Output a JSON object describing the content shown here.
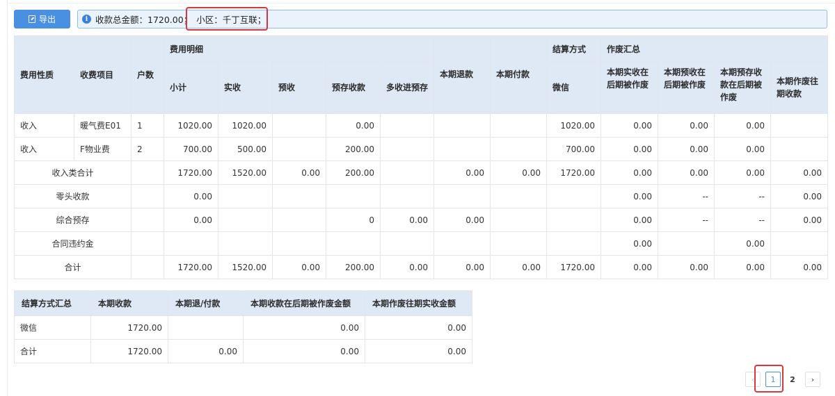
{
  "toolbar": {
    "export_label": "导出"
  },
  "info": {
    "total_text": "收款总金额：1720.00；",
    "community_text": "小区：千丁互联；"
  },
  "main_table": {
    "headers": {
      "nature": "费用性质",
      "item": "收费项目",
      "households": "户数",
      "detail_group": "费用明细",
      "subtotal": "小计",
      "actual": "实收",
      "advance": "预收",
      "prestore": "预存收款",
      "overpay_prestore": "多收进预存",
      "refund": "本期退款",
      "payment": "本期付款",
      "settle_group": "结算方式",
      "wechat": "微信",
      "void_group": "作废汇总",
      "void_actual": "本期实收在后期被作废",
      "void_advance": "本期预收在后期被作废",
      "void_prestore": "本期预存收款在后期被作废",
      "void_past": "本期作废往期收款"
    },
    "rows": [
      {
        "nature": "收入",
        "item": "暖气费E01",
        "households": "1",
        "subtotal": "1020.00",
        "actual": "1020.00",
        "advance": "",
        "prestore": "0.00",
        "overpay": "",
        "refund": "",
        "payment": "",
        "wechat": "1020.00",
        "v1": "0.00",
        "v2": "0.00",
        "v3": "0.00",
        "v4": ""
      },
      {
        "nature": "收入",
        "item": "F物业费",
        "households": "2",
        "subtotal": "700.00",
        "actual": "500.00",
        "advance": "",
        "prestore": "200.00",
        "overpay": "",
        "refund": "",
        "payment": "",
        "wechat": "700.00",
        "v1": "0.00",
        "v2": "0.00",
        "v3": "0.00",
        "v4": ""
      }
    ],
    "summary_rows": [
      {
        "label": "收入类合计",
        "households": "",
        "subtotal": "1720.00",
        "actual": "1520.00",
        "advance": "0.00",
        "prestore": "200.00",
        "overpay": "",
        "refund": "0.00",
        "payment": "0.00",
        "wechat": "1720.00",
        "v1": "0.00",
        "v2": "0.00",
        "v3": "0.00",
        "v4": "0.00"
      },
      {
        "label": "零头收款",
        "households": "",
        "subtotal": "0.00",
        "actual": "",
        "advance": "",
        "prestore": "",
        "overpay": "",
        "refund": "",
        "payment": "",
        "wechat": "",
        "v1": "0.00",
        "v2": "--",
        "v3": "--",
        "v4": "0.00"
      },
      {
        "label": "综合预存",
        "households": "",
        "subtotal": "0.00",
        "actual": "",
        "advance": "",
        "prestore": "0",
        "overpay": "0.00",
        "refund": "0.00",
        "payment": "",
        "wechat": "",
        "v1": "0.00",
        "v2": "--",
        "v3": "--",
        "v4": "0.00"
      },
      {
        "label": "合同违约金",
        "households": "",
        "subtotal": "",
        "actual": "",
        "advance": "",
        "prestore": "",
        "overpay": "",
        "refund": "",
        "payment": "",
        "wechat": "",
        "v1": "0.00",
        "v2": "",
        "v3": "0.00",
        "v4": ""
      },
      {
        "label": "合计",
        "households": "",
        "subtotal": "1720.00",
        "actual": "1520.00",
        "advance": "0.00",
        "prestore": "200.00",
        "overpay": "0.00",
        "refund": "0.00",
        "payment": "0.00",
        "wechat": "1720.00",
        "v1": "0.00",
        "v2": "0.00",
        "v3": "0.00",
        "v4": "0.00"
      }
    ]
  },
  "settle_table": {
    "headers": [
      "结算方式汇总",
      "本期收款",
      "本期退/付款",
      "本期收款在后期被作废金额",
      "本期作废往期实收金额"
    ],
    "rows": [
      [
        "微信",
        "1720.00",
        "",
        "0.00",
        "0.00"
      ],
      [
        "合计",
        "1720.00",
        "0.00",
        "0.00",
        "0.00"
      ]
    ]
  },
  "pagination": {
    "prev": "‹",
    "pages": [
      "1",
      "2"
    ],
    "current": "1",
    "next": "›"
  }
}
